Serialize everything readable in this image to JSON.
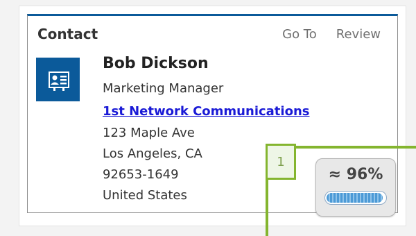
{
  "contact": {
    "title": "Contact",
    "actions": {
      "goto": "Go To",
      "review": "Review"
    },
    "name": "Bob Dickson",
    "job_title": "Marketing Manager",
    "company": "1st Network Communications",
    "address": {
      "street": "123 Maple Ave",
      "city_state": "Los Angeles, CA",
      "zip": "92653-1649",
      "country": "United States"
    },
    "icon": "contact-card-icon"
  },
  "overlay": {
    "tag_label": "1",
    "confidence": "≈ 96%",
    "confidence_level": 0.96
  },
  "colors": {
    "accent": "#0b5a9a",
    "link": "#1a1ad6",
    "highlight": "#84b52f"
  }
}
